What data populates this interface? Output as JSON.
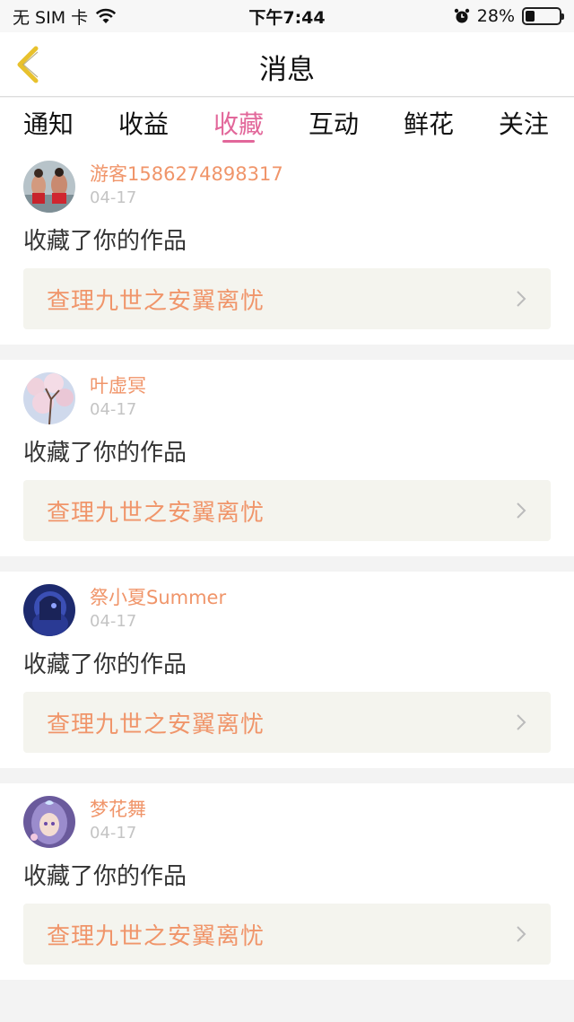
{
  "status_bar": {
    "carrier": "无 SIM 卡",
    "time": "下午7:44",
    "battery_pct": "28%",
    "battery_level": 0.28
  },
  "nav": {
    "title": "消息"
  },
  "tabs": [
    {
      "label": "通知",
      "active": false
    },
    {
      "label": "收益",
      "active": false
    },
    {
      "label": "收藏",
      "active": true
    },
    {
      "label": "互动",
      "active": false
    },
    {
      "label": "鲜花",
      "active": false
    },
    {
      "label": "关注",
      "active": false
    }
  ],
  "items": [
    {
      "username": "游客1586274898317",
      "date": "04-17",
      "action": "收藏了你的作品",
      "work_title": "查理九世之安翼离忧"
    },
    {
      "username": "叶虚冥",
      "date": "04-17",
      "action": "收藏了你的作品",
      "work_title": "查理九世之安翼离忧"
    },
    {
      "username": "祭小夏Summer",
      "date": "04-17",
      "action": "收藏了你的作品",
      "work_title": "查理九世之安翼离忧"
    },
    {
      "username": "梦花舞",
      "date": "04-17",
      "action": "收藏了你的作品",
      "work_title": "查理九世之安翼离忧"
    }
  ],
  "colors": {
    "accent_pink": "#e2679a",
    "accent_orange": "#f0956a",
    "back_arrow": "#e8c12d"
  }
}
